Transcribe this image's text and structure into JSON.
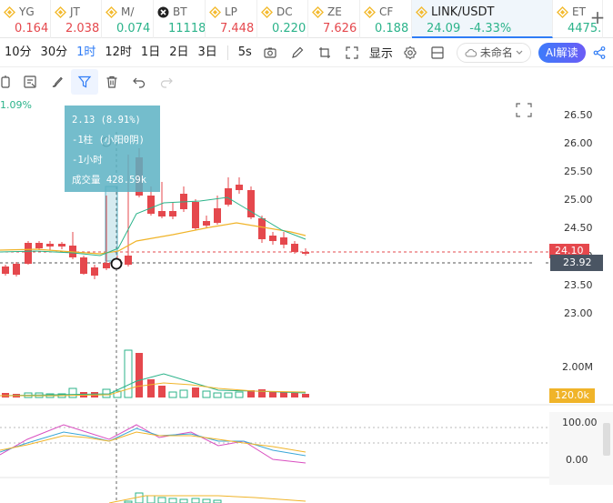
{
  "tickers": [
    {
      "name": "YG",
      "price": "0.164",
      "dir": "down",
      "icon": "coin-icon"
    },
    {
      "name": "JT",
      "price": "2.038",
      "dir": "down",
      "icon": "coin-icon"
    },
    {
      "name": "M/",
      "price": "0.074",
      "dir": "up",
      "icon": "coin-icon"
    },
    {
      "name": "BT",
      "price": "11118",
      "dir": "up",
      "icon": "close-x-icon"
    },
    {
      "name": "LP",
      "price": "7.448",
      "dir": "down",
      "icon": "coin-icon"
    },
    {
      "name": "DC",
      "price": "0.220",
      "dir": "up",
      "icon": "coin-icon"
    },
    {
      "name": "ZE",
      "price": "7.626",
      "dir": "down",
      "icon": "coin-icon"
    },
    {
      "name": "CF",
      "price": "0.188",
      "dir": "up",
      "icon": "coin-icon"
    },
    {
      "name": "LINK/USDT",
      "price": "24.09",
      "change": "-4.33%",
      "dir": "up",
      "icon": "coin-icon",
      "active": true
    },
    {
      "name": "ET",
      "price": "4475.",
      "dir": "up",
      "icon": "coin-icon"
    }
  ],
  "toolbar": {
    "intervals": [
      "10分",
      "30分",
      "1时",
      "12时",
      "1日",
      "2日",
      "3日"
    ],
    "selected_interval": "1时",
    "seconds": "5s",
    "show_label": "显示",
    "cloud_label": "未命名",
    "ai_label": "AI解读"
  },
  "chart": {
    "pct_change": "1.09%",
    "price_axis": [
      "26.50",
      "26.00",
      "25.50",
      "25.00",
      "24.50",
      "24.00",
      "23.50",
      "23.00"
    ],
    "current_price_tag": "24.10",
    "crosshair_price_tag": "23.92",
    "volume_axis": [
      "2.00M"
    ],
    "volume_tag": "120.0k",
    "osc_axis": [
      "100.00",
      "0.00"
    ],
    "tooltip": {
      "line1": "2.13 (8.91%)",
      "line2": "-1柱 (小阳0阴)",
      "line3": "-1小时",
      "line4": "成交量 428.59k"
    },
    "colors": {
      "up": "#2bb38a",
      "down": "#e5484d",
      "ma_yellow": "#f0b429",
      "ma_green": "#2bb38a"
    }
  }
}
